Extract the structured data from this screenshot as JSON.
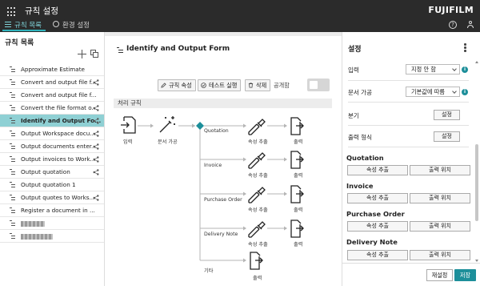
{
  "app": {
    "title": "규칙 설정",
    "brand": "FUJIFILM"
  },
  "tabs": [
    {
      "label": "규칙 목록",
      "active": true
    },
    {
      "label": "환경 설정",
      "active": false
    }
  ],
  "header_icons": [
    "help-icon",
    "user-icon"
  ],
  "left_panel": {
    "title": "규칙 목록",
    "rules": [
      {
        "label": "Approximate Estimate",
        "shared": false,
        "selected": false
      },
      {
        "label": "Convert and output file f...",
        "shared": true,
        "selected": false
      },
      {
        "label": "Convert and output file f...",
        "shared": false,
        "selected": false
      },
      {
        "label": "Convert the file format o...",
        "shared": true,
        "selected": false
      },
      {
        "label": "Identify and Output Fo...",
        "shared": true,
        "selected": true
      },
      {
        "label": "Output Workspace docu...",
        "shared": true,
        "selected": false
      },
      {
        "label": "Output documents enter...",
        "shared": true,
        "selected": false
      },
      {
        "label": "Output invoices to Work...",
        "shared": true,
        "selected": false
      },
      {
        "label": "Output quotation",
        "shared": true,
        "selected": false
      },
      {
        "label": "Output quotation 1",
        "shared": false,
        "selected": false
      },
      {
        "label": "Output quotes to Works...",
        "shared": true,
        "selected": false
      },
      {
        "label": "Register a document in ...",
        "shared": false,
        "selected": false
      },
      {
        "label": "",
        "shared": false,
        "selected": false,
        "redacted": true
      },
      {
        "label": "",
        "shared": false,
        "selected": false,
        "redacted": true
      }
    ]
  },
  "center": {
    "rule_title": "Identify and Output Form",
    "toolbar": {
      "properties": "규칙 속성",
      "test_run": "테스트 실행",
      "delete": "삭제",
      "public_label": "공개함"
    },
    "section_label": "처리 규칙",
    "flow": {
      "input_label": "입력",
      "classify_label": "문서 가공",
      "branches": [
        {
          "name": "Quotation",
          "extract_label": "속성 추출",
          "output_label": "출력"
        },
        {
          "name": "Invoice",
          "extract_label": "속성 추출",
          "output_label": "출력"
        },
        {
          "name": "Purchase Order",
          "extract_label": "속성 추출",
          "output_label": "출력"
        },
        {
          "name": "Delivery Note",
          "extract_label": "속성 추출",
          "output_label": "출력"
        },
        {
          "name": "기타",
          "extract_label": "",
          "output_label": "출력"
        }
      ]
    }
  },
  "right_panel": {
    "title": "설정",
    "input": {
      "label": "입력",
      "value": "지정 안 함"
    },
    "processing": {
      "label": "문서 가공",
      "value": "기본값에 따름"
    },
    "branch": {
      "label": "분기",
      "button": "설정"
    },
    "output_format": {
      "label": "출력 형식",
      "button": "설정"
    },
    "groups": [
      {
        "title": "Quotation",
        "extract": "속성 추출",
        "output_loc": "출력 위치"
      },
      {
        "title": "Invoice",
        "extract": "속성 추출",
        "output_loc": "출력 위치"
      },
      {
        "title": "Purchase Order",
        "extract": "속성 추출",
        "output_loc": "출력 위치"
      },
      {
        "title": "Delivery Note",
        "extract": "속성 추출",
        "output_loc": "출력 위치"
      }
    ],
    "reset": "재설정",
    "save": "저장"
  },
  "colors": {
    "topbar": "#2b2b2b",
    "accent": "#1d8f9a",
    "active_tab": "#7fd3d8",
    "selected_row": "#8fd0d4"
  }
}
